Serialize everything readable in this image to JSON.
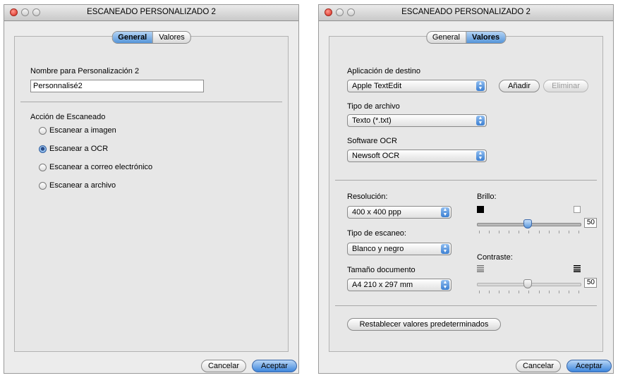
{
  "left_window": {
    "title": "ESCANEADO PERSONALIZADO 2",
    "tabs": [
      {
        "label": "General",
        "active": true
      },
      {
        "label": "Valores",
        "active": false
      }
    ],
    "name_label": "Nombre para Personalización 2",
    "name_value": "Personnalisé2",
    "action_label": "Acción de Escaneado",
    "options": [
      {
        "label": "Escanear a imagen",
        "selected": false
      },
      {
        "label": "Escanear a OCR",
        "selected": true
      },
      {
        "label": "Escanear a correo electrónico",
        "selected": false
      },
      {
        "label": "Escanear a archivo",
        "selected": false
      }
    ],
    "cancel_label": "Cancelar",
    "ok_label": "Aceptar"
  },
  "right_window": {
    "title": "ESCANEADO PERSONALIZADO 2",
    "tabs": [
      {
        "label": "General",
        "active": false
      },
      {
        "label": "Valores",
        "active": true
      }
    ],
    "dest_app_label": "Aplicación de destino",
    "dest_app_value": "Apple TextEdit",
    "add_label": "Añadir",
    "remove_label": "Eliminar",
    "file_type_label": "Tipo de archivo",
    "file_type_value": "Texto (*.txt)",
    "ocr_label": "Software OCR",
    "ocr_value": "Newsoft OCR",
    "resolution_label": "Resolución:",
    "resolution_value": "400 x 400 ppp",
    "scan_type_label": "Tipo de escaneo:",
    "scan_type_value": "Blanco y negro",
    "doc_size_label": "Tamaño documento",
    "doc_size_value": "A4 210 x 297 mm",
    "brightness_label": "Brillo:",
    "brightness_value": "50",
    "contrast_label": "Contraste:",
    "contrast_value": "50",
    "reset_label": "Restablecer valores predeterminados",
    "cancel_label": "Cancelar",
    "ok_label": "Aceptar"
  },
  "colors": {
    "accent": "#3d86dc",
    "window_bg": "#ececec"
  },
  "icons": {
    "close": "close-icon",
    "minimize": "minimize-icon",
    "zoom": "zoom-icon",
    "popup_arrows": "updown-arrows-icon",
    "brightness_dark": "black-square-icon",
    "brightness_light": "white-square-icon",
    "contrast_low": "low-contrast-icon",
    "contrast_high": "high-contrast-icon"
  }
}
